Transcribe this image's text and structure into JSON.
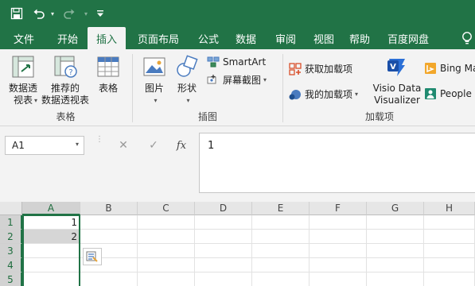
{
  "quick_access": {
    "save_icon": "save-icon",
    "undo_icon": "undo-icon",
    "redo_icon": "redo-icon",
    "customize_icon": "customize-icon"
  },
  "tabs": [
    {
      "label": "文件"
    },
    {
      "label": "开始"
    },
    {
      "label": "插入"
    },
    {
      "label": "页面布局"
    },
    {
      "label": "公式"
    },
    {
      "label": "数据"
    },
    {
      "label": "审阅"
    },
    {
      "label": "视图"
    },
    {
      "label": "帮助"
    },
    {
      "label": "百度网盘"
    }
  ],
  "ribbon": {
    "tables": {
      "group_label": "表格",
      "pivot": "数据透\n视表",
      "recommended": "推荐的\n数据透视表",
      "table": "表格"
    },
    "illustrations": {
      "group_label": "插图",
      "pictures": "图片",
      "shapes": "形状",
      "smartart": "SmartArt",
      "screenshot": "屏幕截图"
    },
    "addins": {
      "group_label": "加载项",
      "get_addins": "获取加载项",
      "my_addins": "我的加载项",
      "visio": "Visio Data\nVisualizer",
      "bing": "Bing Ma",
      "people": "People"
    }
  },
  "formula_bar": {
    "name_box": "A1",
    "value": "1",
    "fx": "fx"
  },
  "grid": {
    "columns": [
      "A",
      "B",
      "C",
      "D",
      "E",
      "F",
      "G",
      "H"
    ],
    "rows": [
      "1",
      "2",
      "3",
      "4",
      "5"
    ],
    "cells": {
      "A1": "1",
      "A2": "2"
    }
  },
  "colors": {
    "accent": "#217346"
  }
}
